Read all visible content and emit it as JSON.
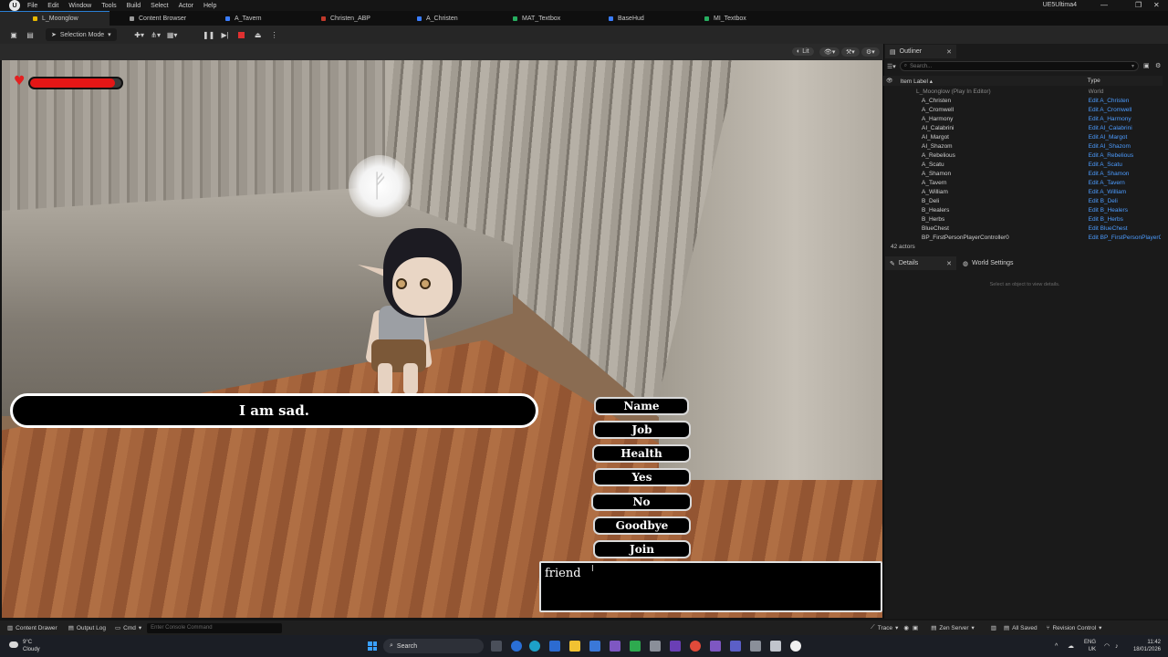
{
  "menu": {
    "items": [
      "File",
      "Edit",
      "Window",
      "Tools",
      "Build",
      "Select",
      "Actor",
      "Help"
    ],
    "project_name": "UE5Ultima4"
  },
  "tabs": [
    {
      "label": "L_Moonglow",
      "color": "#e8b800"
    },
    {
      "label": "Content Browser",
      "color": "#9a9a9a"
    },
    {
      "label": "A_Tavern",
      "color": "#3a7dff"
    },
    {
      "label": "Christen_ABP",
      "color": "#c0392b"
    },
    {
      "label": "A_Christen",
      "color": "#3a7dff"
    },
    {
      "label": "MAT_Textbox",
      "color": "#27ae60"
    },
    {
      "label": "BaseHud",
      "color": "#3a7dff"
    },
    {
      "label": "MI_Textbox",
      "color": "#27ae60"
    }
  ],
  "toolbar": {
    "mode_label": "Selection Mode"
  },
  "viewport": {
    "lit_label": "Lit"
  },
  "hud": {
    "health_fraction": 0.93,
    "health_color": "#e51616"
  },
  "dialogue": {
    "npc_text": "I am sad.",
    "replies": [
      "Name",
      "Job",
      "Health",
      "Yes",
      "No",
      "Goodbye",
      "Join"
    ],
    "input_value": "friend"
  },
  "outliner": {
    "tab_label": "Outliner",
    "search_placeholder": "Search...",
    "col_label": "Item Label ▴",
    "col_type": "Type",
    "root": {
      "name": "L_Moonglow (Play In Editor)",
      "type": "World"
    },
    "rows": [
      {
        "name": "A_Christen",
        "type": "Edit A_Christen"
      },
      {
        "name": "A_Cromwell",
        "type": "Edit A_Cromwell"
      },
      {
        "name": "A_Harmony",
        "type": "Edit A_Harmony"
      },
      {
        "name": "AI_Calabrini",
        "type": "Edit AI_Calabrini"
      },
      {
        "name": "AI_Margot",
        "type": "Edit AI_Margot"
      },
      {
        "name": "AI_Shazom",
        "type": "Edit AI_Shazom"
      },
      {
        "name": "A_Rebelious",
        "type": "Edit A_Rebelious"
      },
      {
        "name": "A_Scatu",
        "type": "Edit A_Scatu"
      },
      {
        "name": "A_Shamon",
        "type": "Edit A_Shamon"
      },
      {
        "name": "A_Tavern",
        "type": "Edit A_Tavern"
      },
      {
        "name": "A_William",
        "type": "Edit A_William"
      },
      {
        "name": "B_Deli",
        "type": "Edit B_Deli"
      },
      {
        "name": "B_Healers",
        "type": "Edit B_Healers"
      },
      {
        "name": "B_Herbs",
        "type": "Edit B_Herbs"
      },
      {
        "name": "BlueChest",
        "type": "Edit BlueChest"
      },
      {
        "name": "BP_FirstPersonPlayerController0",
        "type": "Edit BP_FirstPersonPlayerC"
      }
    ],
    "actor_count": "42 actors"
  },
  "details": {
    "tab_label": "Details",
    "world_settings_label": "World Settings",
    "empty_hint": "Select an object to view details."
  },
  "statusbar": {
    "content_drawer": "Content Drawer",
    "output_log": "Output Log",
    "cmd": "Cmd",
    "console_placeholder": "Enter Console Command",
    "trace": "Trace",
    "zen_server": "Zen Server",
    "all_saved": "All Saved",
    "revision_control": "Revision Control"
  },
  "taskbar": {
    "temperature": "9°C",
    "weather": "Cloudy",
    "search_label": "Search",
    "lang_line1": "ENG",
    "lang_line2": "UK",
    "time": "11:42",
    "date": "18/01/2026"
  }
}
